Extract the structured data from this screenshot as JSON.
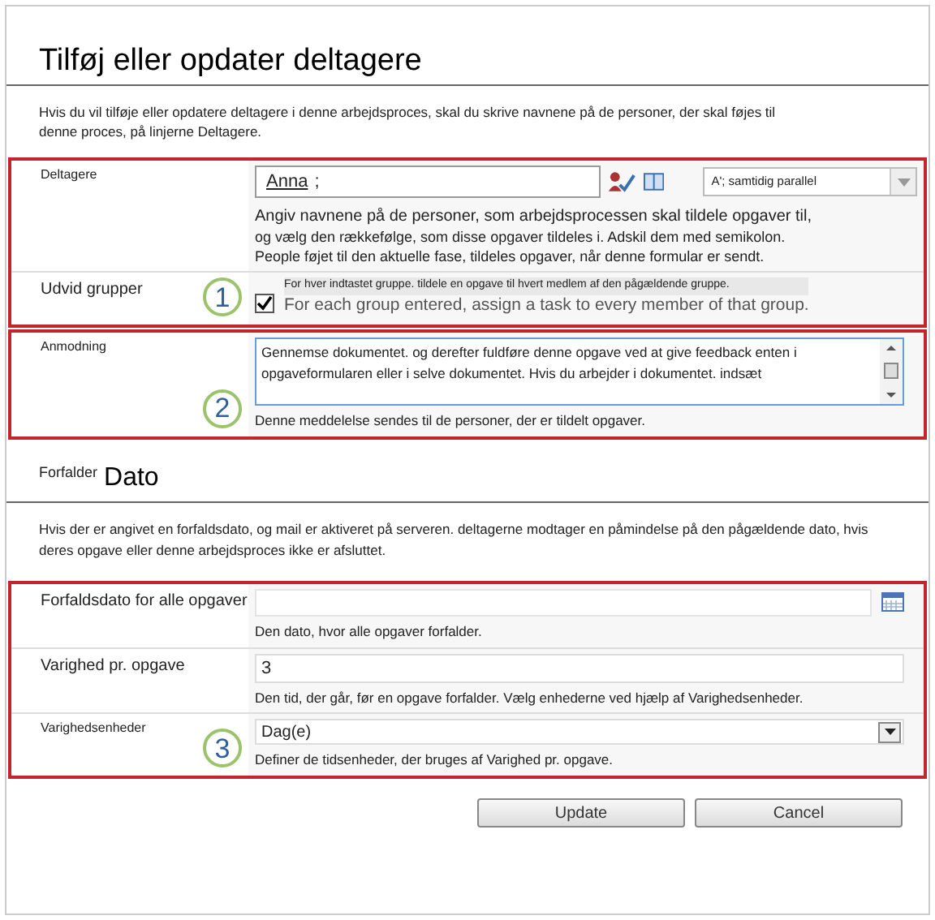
{
  "title": "Tilføj eller opdater deltagere",
  "intro": "Hvis du vil tilføje eller opdatere deltagere i denne arbejdsproces, skal du skrive navnene på de personer, der skal føjes til denne proces, på linjerne Deltagere.",
  "participants": {
    "label": "Deltagere",
    "value": "Anna",
    "separator": ";",
    "order": "A'; samtidig parallel",
    "help_lines": [
      "Angiv navnene på de personer, som arbejdsprocessen skal tildele opgaver til,",
      "og vælg den rækkefølge, som disse opgaver tildeles i. Adskil dem med semikolon.",
      "People føjet til den aktuelle fase, tildeles opgaver, når denne formular er sendt."
    ]
  },
  "expand_groups": {
    "label": "Udvid grupper",
    "callout": "1",
    "checked": true,
    "text": "For hver indtastet gruppe. tildele en opgave til hvert medlem af den pågældende gruppe.",
    "text_en": "For each group entered, assign a task to every member of that group."
  },
  "request": {
    "label": "Anmodning",
    "callout": "2",
    "value": "Gennemse dokumentet. og derefter fuldføre denne opgave ved at give feedback enten i opgaveformularen eller i selve dokumentet. Hvis du arbejder i dokumentet. indsæt",
    "help": "Denne meddelelse sendes til de personer, der er tildelt opgaver."
  },
  "due_heading": {
    "small": "Forfalder",
    "large": "Dato"
  },
  "due_intro": "Hvis der er angivet en forfaldsdato, og mail er aktiveret på serveren. deltagerne modtager en påmindelse på den pågældende dato, hvis deres opgave eller denne arbejdsproces ikke er afsluttet.",
  "fields": [
    {
      "kind": "date",
      "label": "Forfaldsdato for alle opgaver",
      "help": "Den dato, hvor alle opgaver forfalder."
    },
    {
      "kind": "text",
      "label": "Varighed pr. opgave",
      "value": "3",
      "help": "Den tid, der går, før en opgave forfalder. Vælg enhederne ved hjælp af Varighedsenheder."
    },
    {
      "kind": "select",
      "label": "Varighedsenheder",
      "callout": "3",
      "value": "Dag(e)",
      "help": "Definer de tidsenheder, der bruges af Varighed pr. opgave."
    }
  ],
  "buttons": [
    "Update",
    "Cancel"
  ]
}
